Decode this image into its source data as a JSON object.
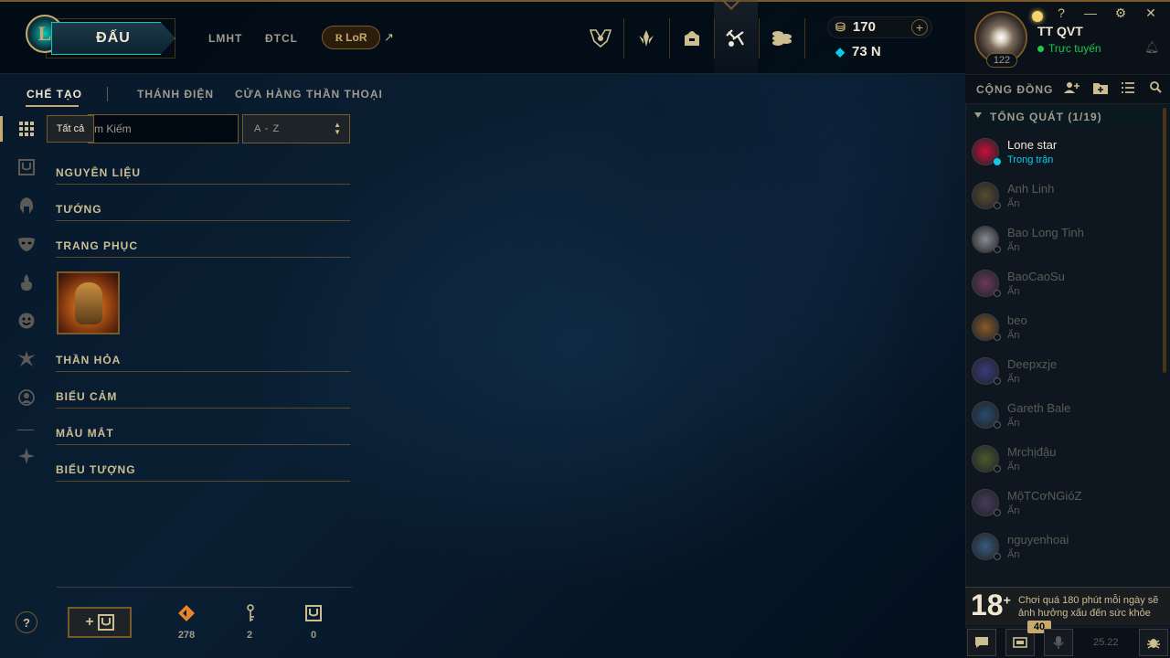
{
  "topbar": {
    "play_label": "ĐẤU",
    "nav": [
      "LMHT",
      "ĐTCL"
    ],
    "lor_label": "LoR",
    "rp": "170",
    "be": "73 N"
  },
  "profile": {
    "name": "TT QVT",
    "status": "Trực tuyến",
    "level": "122"
  },
  "social": {
    "title": "CỘNG ĐỒNG",
    "group_label": "TỔNG QUÁT (1/19)",
    "friends": [
      {
        "name": "Lone star",
        "status": "Trong trận",
        "color": "#c8103a"
      },
      {
        "name": "Anh Linh",
        "status": "Ẩn",
        "color": "#5a4a30"
      },
      {
        "name": "Bao Long Tinh",
        "status": "Ẩn",
        "color": "#8a8a90"
      },
      {
        "name": "BaoCaoSu",
        "status": "Ẩn",
        "color": "#6a3a5a"
      },
      {
        "name": "beo",
        "status": "Ẩn",
        "color": "#8a5a2a"
      },
      {
        "name": "Deepxzje",
        "status": "Ẩn",
        "color": "#3a3a7a"
      },
      {
        "name": "Gareth Bale",
        "status": "Ẩn",
        "color": "#2a4a6a"
      },
      {
        "name": "Mrchịđậu",
        "status": "Ẩn",
        "color": "#4a5a2a"
      },
      {
        "name": "MộTCơNGióZ",
        "status": "Ẩn",
        "color": "#4a3a5a"
      },
      {
        "name": "nguyenhoai",
        "status": "Ẩn",
        "color": "#3a5a7a"
      }
    ],
    "warning_age": "18",
    "warning_text": "Chơi quá 180 phút mỗi ngày sẽ ảnh hưởng xấu đến sức khỏe",
    "badge_count": "40",
    "patch": "25.22"
  },
  "crafting": {
    "tabs": [
      "CHẾ TẠO",
      "THÁNH ĐIỆN",
      "CỬA HÀNG THẦN THOẠI"
    ],
    "tooltip": "Tất cả",
    "search_text": "m Kiếm",
    "sort_label": "A - Z",
    "categories": [
      "NGUYÊN LIỆU",
      "TƯỚNG",
      "TRANG PHỤC",
      "THẦN HỎA",
      "BIỂU CẢM",
      "MẪU MẮT",
      "BIỂU TƯỢNG"
    ],
    "resources": [
      {
        "icon": "orange-essence-icon",
        "count": "278"
      },
      {
        "icon": "key-icon",
        "count": "2"
      },
      {
        "icon": "chest-icon",
        "count": "0"
      }
    ]
  }
}
